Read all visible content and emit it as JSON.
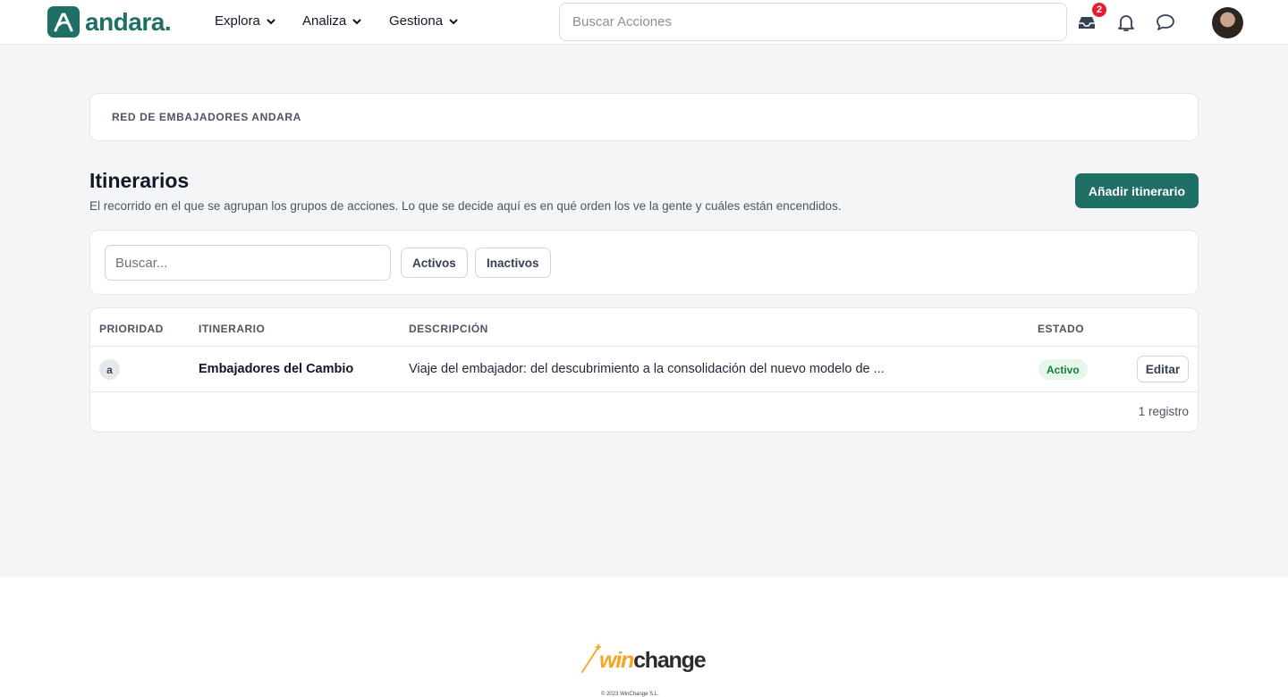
{
  "header": {
    "logo_text": "andara.",
    "nav": [
      {
        "label": "Explora"
      },
      {
        "label": "Analiza"
      },
      {
        "label": "Gestiona"
      }
    ],
    "search_placeholder": "Buscar Acciones",
    "inbox_count": "2"
  },
  "org": {
    "name": "RED DE EMBAJADORES ANDARA"
  },
  "page": {
    "title": "Itinerarios",
    "subtitle": "El recorrido en el que se agrupan los grupos de acciones. Lo que se decide aquí es en qué orden los ve la gente y cuáles están encendidos.",
    "add_button": "Añadir itinerario"
  },
  "filters": {
    "search_placeholder": "Buscar...",
    "active_label": "Activos",
    "inactive_label": "Inactivos"
  },
  "table": {
    "columns": [
      "PRIORIDAD",
      "ITINERARIO",
      "DESCRIPCIÓN",
      "ESTADO"
    ],
    "rows": [
      {
        "priority": "a",
        "name": "Embajadores del Cambio",
        "description": "Viaje del embajador: del descubrimiento a la consolidación del nuevo modelo de ...",
        "status": "Activo",
        "action": "Editar"
      }
    ],
    "count_label": "1 registro"
  },
  "footer": {
    "brand_win": "win",
    "brand_change": "change",
    "copyright": "© 2023 WinChange S.L."
  },
  "colors": {
    "brand": "#1f6f66",
    "status_active_bg": "#e5f6ea",
    "status_active_text": "#15803d",
    "badge": "#e11d2e"
  }
}
